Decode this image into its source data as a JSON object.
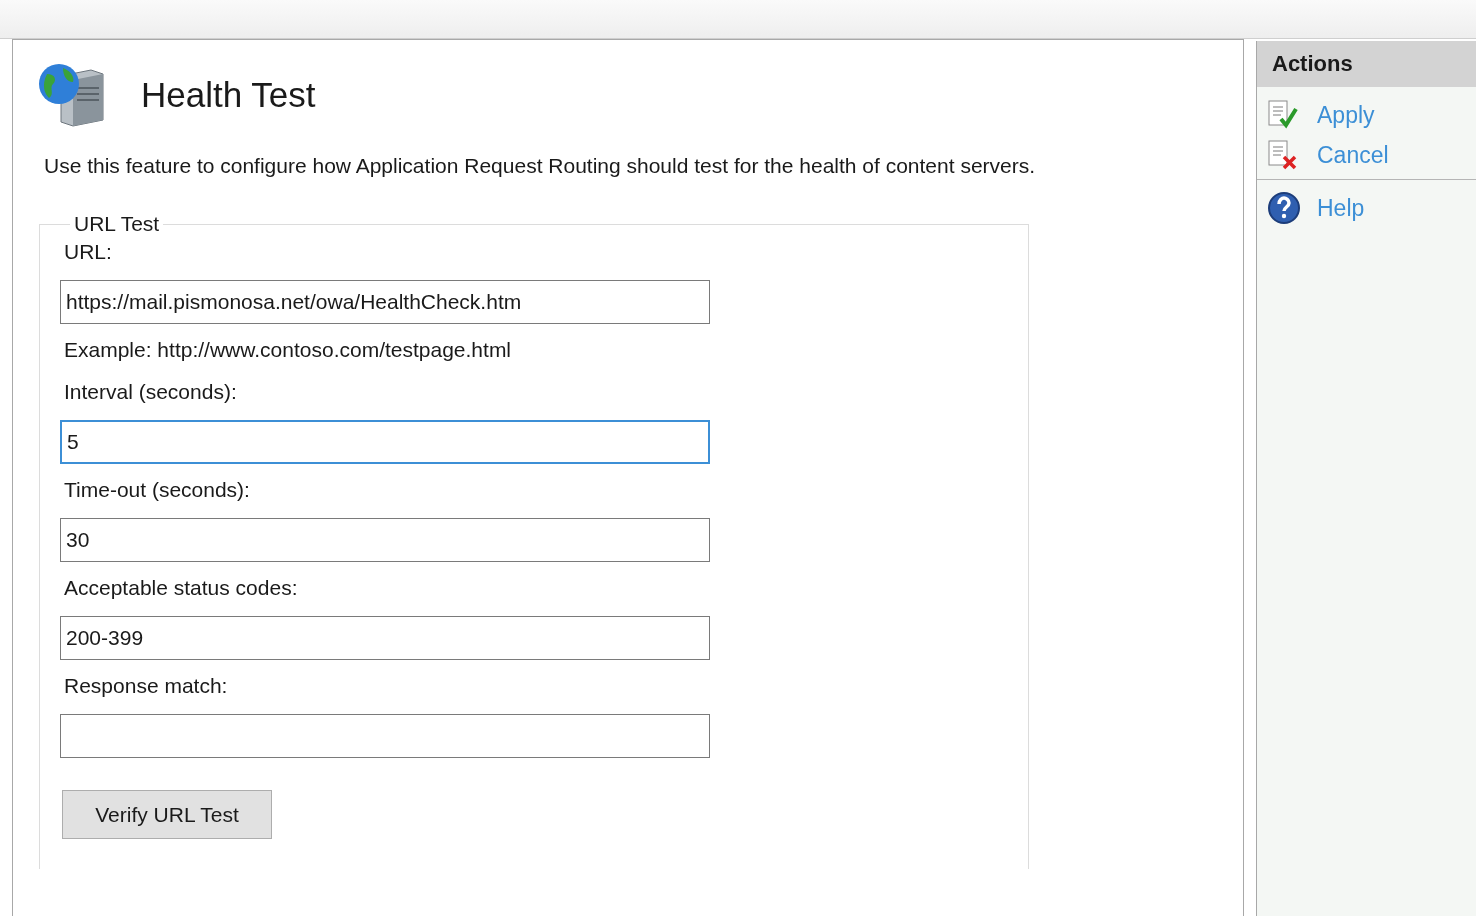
{
  "header": {
    "title": "Health Test",
    "description": "Use this feature to configure how Application Request Routing should test for the health of content servers."
  },
  "url_test": {
    "legend": "URL Test",
    "fields": [
      {
        "label": "URL:",
        "value": "https://mail.pismonosa.net/owa/HealthCheck.htm",
        "focused": false,
        "example": "Example: http://www.contoso.com/testpage.html"
      },
      {
        "label": "Interval (seconds):",
        "value": "5",
        "focused": true
      },
      {
        "label": "Time-out (seconds):",
        "value": "30",
        "focused": false
      },
      {
        "label": "Acceptable status codes:",
        "value": "200-399",
        "focused": false
      },
      {
        "label": "Response match:",
        "focused": false
      }
    ],
    "verify_button": "Verify URL Test"
  },
  "actions": {
    "title": "Actions",
    "groups": [
      [
        {
          "label": "Apply",
          "kind": "apply"
        },
        {
          "label": "Cancel",
          "kind": "cancel"
        }
      ],
      [
        {
          "label": "Help",
          "kind": "help"
        }
      ]
    ]
  }
}
